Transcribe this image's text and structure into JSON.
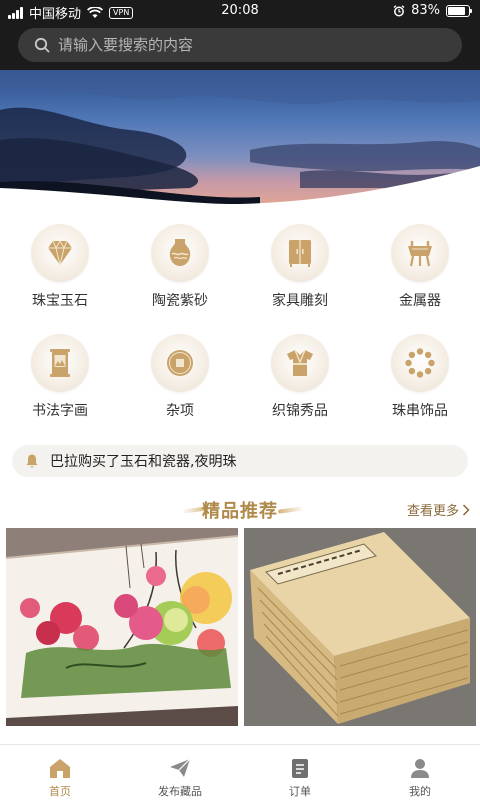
{
  "status_bar": {
    "carrier": "中国移动",
    "vpn": "VPN",
    "time": "20:08",
    "battery_text": "83%",
    "battery_level": 0.83
  },
  "search": {
    "placeholder": "请输入要搜索的内容"
  },
  "categories": [
    {
      "label": "珠宝玉石",
      "icon": "gem-icon"
    },
    {
      "label": "陶瓷紫砂",
      "icon": "vase-icon"
    },
    {
      "label": "家具雕刻",
      "icon": "cabinet-icon"
    },
    {
      "label": "金属器",
      "icon": "bronze-ding-icon"
    },
    {
      "label": "书法字画",
      "icon": "painting-scroll-icon"
    },
    {
      "label": "杂项",
      "icon": "coin-icon"
    },
    {
      "label": "织锦秀品",
      "icon": "robe-icon"
    },
    {
      "label": "珠串饰品",
      "icon": "bead-bracelet-icon"
    }
  ],
  "notice": {
    "text": "巴拉购买了玉石和瓷器,夜明珠"
  },
  "featured": {
    "title": "精品推荐",
    "see_more": "查看更多"
  },
  "products": [
    {
      "image": "peony-painting-image"
    },
    {
      "image": "ancient-book-stack-image"
    }
  ],
  "tabbar": [
    {
      "label": "首页",
      "icon": "home-icon",
      "active": true
    },
    {
      "label": "发布藏品",
      "icon": "paper-plane-icon",
      "active": false
    },
    {
      "label": "订单",
      "icon": "order-list-icon",
      "active": false
    },
    {
      "label": "我的",
      "icon": "user-icon",
      "active": false
    }
  ],
  "colors": {
    "accent": "#b08a4a",
    "dark_header": "#1b1b1b",
    "icon_gold": "#c9a36a"
  }
}
